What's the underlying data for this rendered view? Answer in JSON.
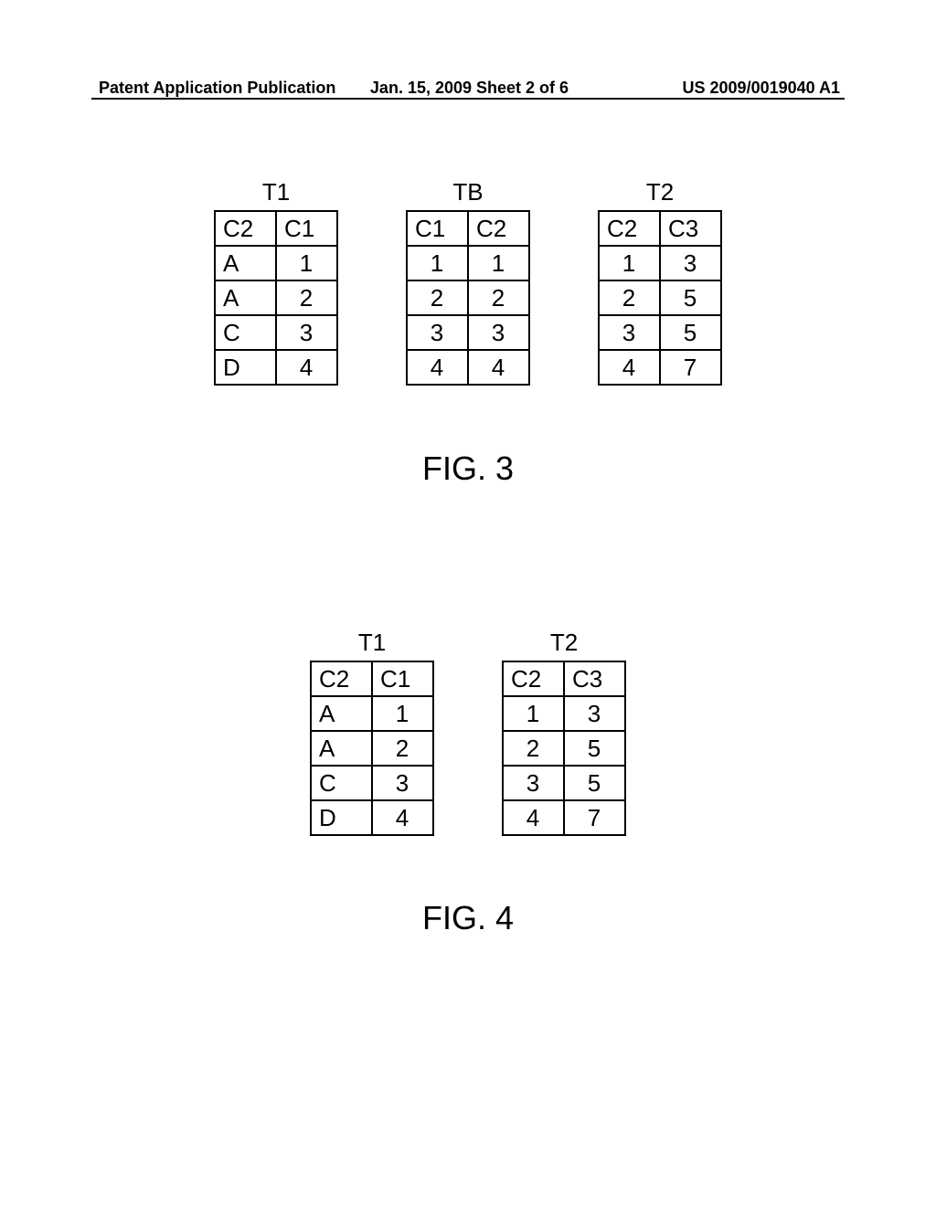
{
  "header": {
    "left": "Patent Application Publication",
    "center": "Jan. 15, 2009   Sheet 2 of 6",
    "right": "US 2009/0019040 A1"
  },
  "fig3": {
    "label": "FIG. 3",
    "tables": [
      {
        "title": "T1",
        "headers": [
          "C2",
          "C1"
        ],
        "rows": [
          [
            "A",
            "1"
          ],
          [
            "A",
            "2"
          ],
          [
            "C",
            "3"
          ],
          [
            "D",
            "4"
          ]
        ],
        "align": [
          "left",
          "center"
        ]
      },
      {
        "title": "TB",
        "headers": [
          "C1",
          "C2"
        ],
        "rows": [
          [
            "1",
            "1"
          ],
          [
            "2",
            "2"
          ],
          [
            "3",
            "3"
          ],
          [
            "4",
            "4"
          ]
        ],
        "align": [
          "center",
          "center"
        ]
      },
      {
        "title": "T2",
        "headers": [
          "C2",
          "C3"
        ],
        "rows": [
          [
            "1",
            "3"
          ],
          [
            "2",
            "5"
          ],
          [
            "3",
            "5"
          ],
          [
            "4",
            "7"
          ]
        ],
        "align": [
          "center",
          "center"
        ]
      }
    ]
  },
  "fig4": {
    "label": "FIG. 4",
    "tables": [
      {
        "title": "T1",
        "headers": [
          "C2",
          "C1"
        ],
        "rows": [
          [
            "A",
            "1"
          ],
          [
            "A",
            "2"
          ],
          [
            "C",
            "3"
          ],
          [
            "D",
            "4"
          ]
        ],
        "align": [
          "left",
          "center"
        ]
      },
      {
        "title": "T2",
        "headers": [
          "C2",
          "C3"
        ],
        "rows": [
          [
            "1",
            "3"
          ],
          [
            "2",
            "5"
          ],
          [
            "3",
            "5"
          ],
          [
            "4",
            "7"
          ]
        ],
        "align": [
          "center",
          "center"
        ]
      }
    ]
  },
  "chart_data": [
    {
      "type": "table",
      "title": "T1",
      "categories": [
        "C2",
        "C1"
      ],
      "series": [
        {
          "name": "row1",
          "values": [
            "A",
            "1"
          ]
        },
        {
          "name": "row2",
          "values": [
            "A",
            "2"
          ]
        },
        {
          "name": "row3",
          "values": [
            "C",
            "3"
          ]
        },
        {
          "name": "row4",
          "values": [
            "D",
            "4"
          ]
        }
      ]
    },
    {
      "type": "table",
      "title": "TB",
      "categories": [
        "C1",
        "C2"
      ],
      "series": [
        {
          "name": "row1",
          "values": [
            "1",
            "1"
          ]
        },
        {
          "name": "row2",
          "values": [
            "2",
            "2"
          ]
        },
        {
          "name": "row3",
          "values": [
            "3",
            "3"
          ]
        },
        {
          "name": "row4",
          "values": [
            "4",
            "4"
          ]
        }
      ]
    },
    {
      "type": "table",
      "title": "T2",
      "categories": [
        "C2",
        "C3"
      ],
      "series": [
        {
          "name": "row1",
          "values": [
            "1",
            "3"
          ]
        },
        {
          "name": "row2",
          "values": [
            "2",
            "5"
          ]
        },
        {
          "name": "row3",
          "values": [
            "3",
            "5"
          ]
        },
        {
          "name": "row4",
          "values": [
            "4",
            "7"
          ]
        }
      ]
    }
  ]
}
